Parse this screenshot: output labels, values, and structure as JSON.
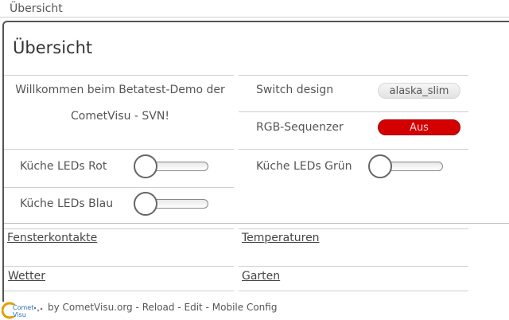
{
  "window": {
    "title": "Übersicht"
  },
  "page": {
    "title": "Übersicht"
  },
  "welcome": {
    "line1": "Willkommen beim Betatest-Demo der",
    "line2": "CometVisu - SVN!"
  },
  "design": {
    "label": "Switch design",
    "value": "alaska_slim"
  },
  "rgb": {
    "label": "RGB-Sequenzer",
    "value": "Aus",
    "color": "#d40000"
  },
  "sliders": [
    {
      "label": "Küche LEDs Rot",
      "level": 0
    },
    {
      "label": "Küche LEDs Grün",
      "level": 0
    },
    {
      "label": "Küche LEDs Blau",
      "level": 0
    }
  ],
  "links": [
    {
      "label": "Fensterkontakte"
    },
    {
      "label": "Temperaturen"
    },
    {
      "label": "Wetter"
    },
    {
      "label": "Garten"
    }
  ],
  "footer": {
    "logo_text": "Comet Visu",
    "prefix": "by",
    "site": "CometVisu.org",
    "sep": "-",
    "reload": "Reload",
    "edit": "Edit",
    "mobile": "Mobile Config"
  }
}
